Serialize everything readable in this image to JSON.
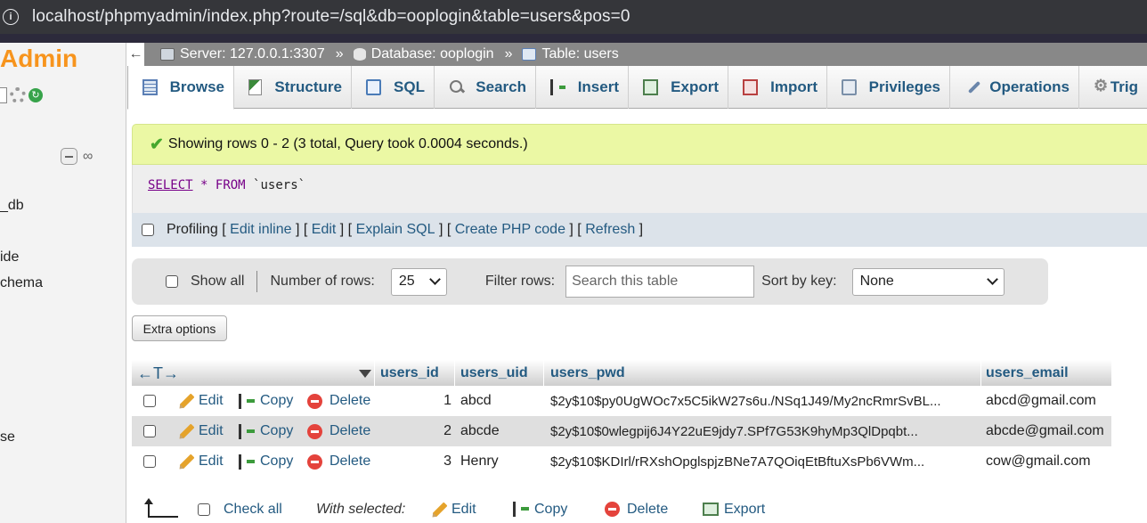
{
  "browser": {
    "url": "localhost/phpmyadmin/index.php?route=/sql&db=ooplogin&table=users&pos=0"
  },
  "nav": {
    "logo": "Admin",
    "items": [
      "_db",
      "ide",
      "chema",
      "se"
    ]
  },
  "breadcrumb": {
    "server": "Server: 127.0.0.1:3307",
    "database": "Database: ooplogin",
    "table": "Table: users",
    "separator": "»"
  },
  "tabs": [
    {
      "label": "Browse",
      "icon": "browse-icon"
    },
    {
      "label": "Structure",
      "icon": "structure-icon"
    },
    {
      "label": "SQL",
      "icon": "sql-icon"
    },
    {
      "label": "Search",
      "icon": "search-icon"
    },
    {
      "label": "Insert",
      "icon": "insert-icon"
    },
    {
      "label": "Export",
      "icon": "export-icon"
    },
    {
      "label": "Import",
      "icon": "import-icon"
    },
    {
      "label": "Privileges",
      "icon": "privileges-icon"
    },
    {
      "label": "Operations",
      "icon": "operations-icon"
    },
    {
      "label": "Trig",
      "icon": "triggers-icon"
    }
  ],
  "message": "Showing rows 0 - 2 (3 total, Query took 0.0004 seconds.)",
  "query": {
    "select": "SELECT",
    "star": "*",
    "from": "FROM",
    "table": "`users`"
  },
  "profiling": {
    "label": "Profiling",
    "links": [
      "Edit inline",
      "Edit",
      "Explain SQL",
      "Create PHP code",
      "Refresh"
    ]
  },
  "controls": {
    "show_all": "Show all",
    "num_rows_label": "Number of rows:",
    "num_rows_value": "25",
    "filter_label": "Filter rows:",
    "filter_placeholder": "Search this table",
    "sort_label": "Sort by key:",
    "sort_value": "None",
    "extra_options": "Extra options"
  },
  "table": {
    "columns": [
      "users_id",
      "users_uid",
      "users_pwd",
      "users_email"
    ],
    "actions": {
      "edit": "Edit",
      "copy": "Copy",
      "delete": "Delete"
    },
    "rows": [
      {
        "id": "1",
        "uid": "abcd",
        "pwd": "$2y$10$py0UgWOc7x5C5ikW27s6u./NSq1J49/My2ncRmrSvBL...",
        "email": "abcd@gmail.com"
      },
      {
        "id": "2",
        "uid": "abcde",
        "pwd": "$2y$10$0wlegpij6J4Y22uE9jdy7.SPf7G53K9hyMp3QlDpqbt...",
        "email": "abcde@gmail.com"
      },
      {
        "id": "3",
        "uid": "Henry",
        "pwd": "$2y$10$KDIrl/rRXshOpglspjzBNe7A7QOiqEtBftuXsPb6VWm...",
        "email": "cow@gmail.com"
      }
    ]
  },
  "footer": {
    "check_all": "Check all",
    "with_selected": "With selected:",
    "edit": "Edit",
    "copy": "Copy",
    "delete": "Delete",
    "export": "Export"
  }
}
